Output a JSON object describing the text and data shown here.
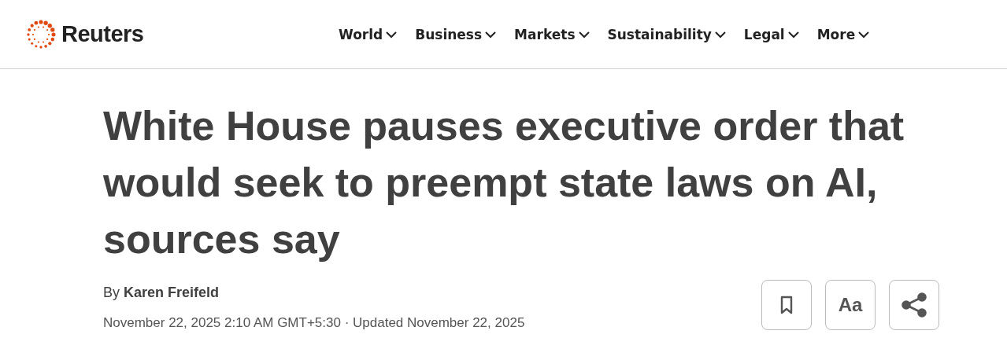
{
  "header": {
    "logo_text": "Reuters",
    "nav": [
      {
        "label": "World",
        "expanded": false
      },
      {
        "label": "Business",
        "expanded": false
      },
      {
        "label": "Markets",
        "expanded": false
      },
      {
        "label": "Sustainability",
        "expanded": false
      },
      {
        "label": "Legal",
        "expanded": false
      },
      {
        "label": "More",
        "expanded": false
      }
    ]
  },
  "article": {
    "headline": "White House pauses executive order that would seek to preempt state laws on AI, sources say",
    "byline": "By **Karen Freifeld**",
    "dateline": "November 22, 2025 2:10 AM GMT+5:30 · Updated November 22, 2025",
    "tools": [
      {
        "kind": "bookmark"
      },
      {
        "kind": "text",
        "label": "Aa"
      },
      {
        "kind": "share"
      }
    ]
  }
}
